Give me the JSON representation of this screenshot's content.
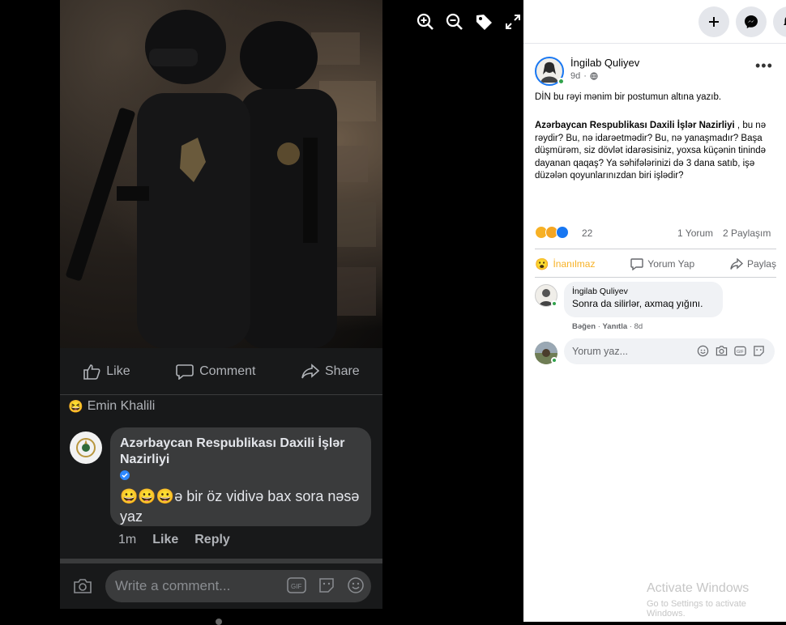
{
  "viewer": {
    "toolbar": [
      "zoom-in-icon",
      "zoom-out-icon",
      "tag-icon",
      "fullscreen-icon"
    ],
    "actions": {
      "like": "Like",
      "comment": "Comment",
      "share": "Share"
    },
    "reactor_name": "Emin Khalili",
    "comment": {
      "author": "Azərbaycan Respublikası Daxili İşlər Nazirliyi",
      "text": "ə bir öz vidivə bax sora nəsə yaz",
      "emoji": "😀😀😀",
      "time": "1m",
      "like": "Like",
      "reply": "Reply"
    },
    "write_placeholder": "Write a comment..."
  },
  "panel": {
    "author": "İngilab Quliyev",
    "time": "9d",
    "more": "•••",
    "intro": "DİN bu rəyi mənim bir postumun altına yazıb.",
    "body_bold": "Azərbaycan Respublikası Daxili İşlər Nazirliyi",
    "body_rest": " , bu nə rəydir? Bu, nə idarəetmədir? Bu, nə yanaşmadır? Başa düşmürəm, siz dövlət idarəsisiniz, yoxsa küçənin tinində dayanan qaqaş? Ya səhifələrinizi də 3 dana satıb, işə düzələn qoyunlarınızdan biri işlədir?",
    "reaction_count": "22",
    "comments_count": "1 Yorum",
    "shares_count": "2 Paylaşım",
    "actions": {
      "react": "İnanılmaz",
      "comment": "Yorum Yap",
      "share": "Paylaş"
    },
    "comment": {
      "author": "İngilab Quliyev",
      "text": "Sonra da silirlər, axmaq yığını.",
      "like": "Bəğen",
      "reply": "Yanıtla",
      "time": "8d"
    },
    "write_placeholder": "Yorum yaz...",
    "watermark_title": "Activate Windows",
    "watermark_sub": "Go to Settings to activate Windows."
  },
  "colors": {
    "fb_blue": "#1877f2",
    "online_green": "#31a24c",
    "wow_yellow": "#f7b125"
  }
}
